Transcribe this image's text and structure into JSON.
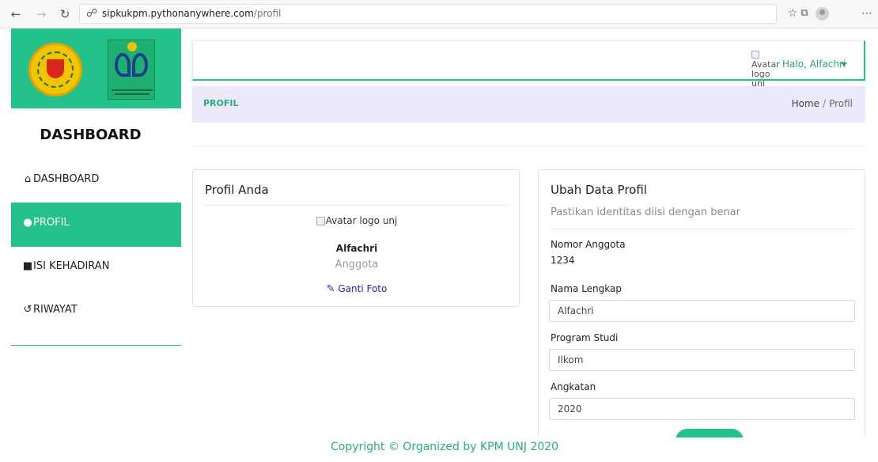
{
  "browser": {
    "url_domain": "sipkukpm.pythonanywhere.com",
    "url_path": "/profil",
    "icons": [
      "back-icon",
      "forward-icon",
      "refresh-icon",
      "globe-icon",
      "favorites-icon",
      "collections-icon",
      "profile-icon",
      "more-icon"
    ]
  },
  "sidebar": {
    "title": "DASHBOARD",
    "items": [
      {
        "label": "DASHBOARD",
        "icon": "home-icon",
        "active": false
      },
      {
        "label": "PROFIL",
        "icon": "user-icon",
        "active": true
      },
      {
        "label": "ISI KEHADIRAN",
        "icon": "book-icon",
        "active": false
      },
      {
        "label": "RIWAYAT",
        "icon": "history-icon",
        "active": false
      }
    ]
  },
  "topbar": {
    "avatar_alt": "Avatar logo unj",
    "greeting": "Halo, Alfachri"
  },
  "pagebar": {
    "title": "PROFIL",
    "breadcrumb_home": "Home",
    "breadcrumb_sep": "/",
    "breadcrumb_current": "Profil"
  },
  "profile_card": {
    "title": "Profil Anda",
    "avatar_alt": "Avatar logo unj",
    "name": "Alfachri",
    "role": "Anggota",
    "change_photo": "Ganti Foto"
  },
  "edit_card": {
    "title": "Ubah Data Profil",
    "subtitle": "Pastikan identitas diisi dengan benar",
    "member_number_label": "Nomor Anggota",
    "member_number": "1234",
    "full_name_label": "Nama Lengkap",
    "full_name": "Alfachri",
    "study_program_label": "Program Studi",
    "study_program": "Ilkom",
    "year_label": "Angkatan",
    "year": "2020",
    "submit_label": ""
  },
  "footer": {
    "text": "Copyright © Organized by KPM UNJ 2020"
  },
  "colors": {
    "accent": "#24c28a",
    "pagebar_bg": "#ece9fb",
    "link": "#2222cc"
  }
}
